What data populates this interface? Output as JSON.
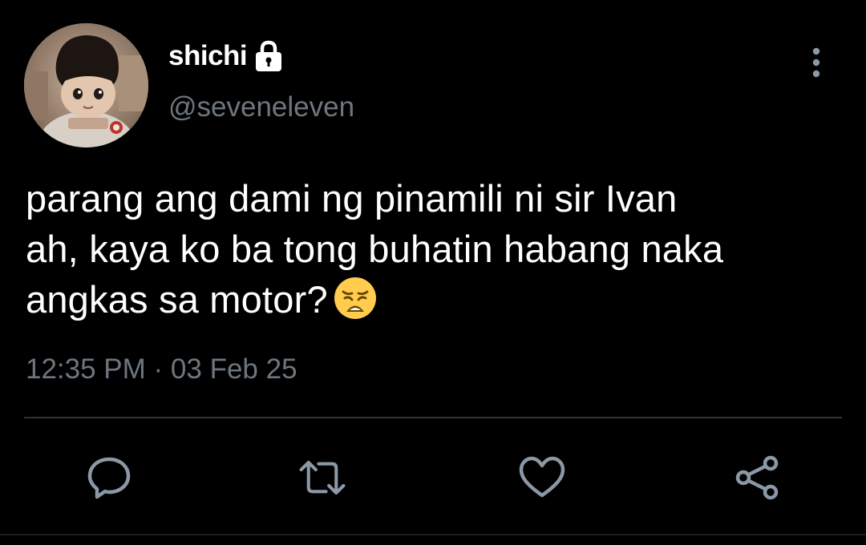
{
  "tweet": {
    "author": {
      "display_name": "shichi",
      "handle": "@seveneleven",
      "protected_icon": "lock-icon",
      "avatar_icon": "avatar-image"
    },
    "text_lines": [
      "parang ang dami ng pinamili ni sir Ivan",
      "ah, kaya ko ba tong buhatin habang naka",
      "angkas sa motor?"
    ],
    "emoji": "weary-face-emoji",
    "timestamp": "12:35 PM · 03 Feb 25"
  },
  "menu": {
    "icon": "more-vertical-icon"
  },
  "actions": [
    {
      "name": "reply",
      "icon": "comment-icon"
    },
    {
      "name": "retweet",
      "icon": "retweet-icon"
    },
    {
      "name": "like",
      "icon": "heart-icon"
    },
    {
      "name": "share",
      "icon": "share-icon"
    }
  ],
  "colors": {
    "background": "#000000",
    "text_primary": "#ffffff",
    "text_secondary": "#6e767d",
    "icon": "#8b98a5",
    "divider": "#2f3336"
  }
}
